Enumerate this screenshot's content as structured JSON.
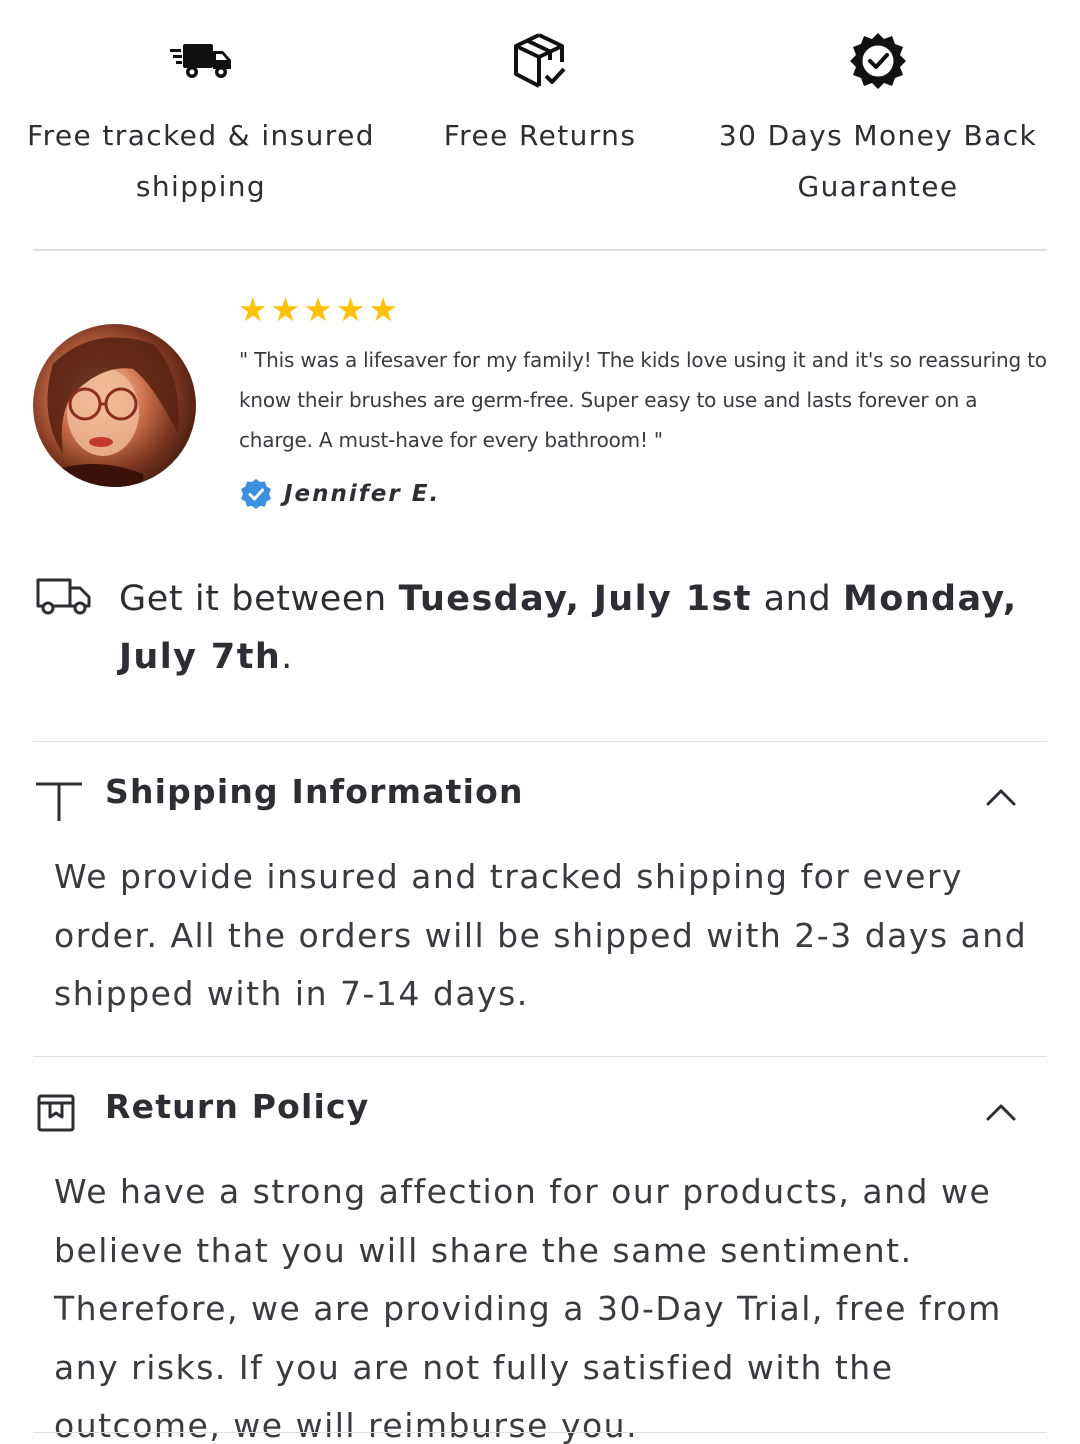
{
  "badges": [
    {
      "icon": "fast-truck-icon",
      "text": "Free tracked & insured shipping"
    },
    {
      "icon": "box-check-icon",
      "text": "Free Returns"
    },
    {
      "icon": "badge-check-icon",
      "text": "30 Days Money Back Guarantee"
    }
  ],
  "review": {
    "rating": 5,
    "stars": "★★★★★",
    "quote": "\" This was a lifesaver for my family! The kids love using it and it's so reassuring to know their brushes are germ-free. Super easy to use and lasts forever on a charge. A must-have for every bathroom! \"",
    "reviewer": "Jennifer E.",
    "verified_icon": "verified-check-icon",
    "star_color": "#ffc107",
    "verified_color": "#3d8fe0"
  },
  "delivery": {
    "icon": "delivery-truck-icon",
    "prefix": "Get it between ",
    "start": "Tuesday, July 1st",
    "middle": " and ",
    "end": "Monday, July 7th",
    "suffix": "."
  },
  "accordions": [
    {
      "icon": "truck-outline-icon",
      "title": "Shipping Information",
      "expanded": true,
      "body": "We provide insured and tracked shipping for every order. All the orders will be shipped with 2-3 days and shipped with in 7-14 days."
    },
    {
      "icon": "return-box-icon",
      "title": "Return Policy",
      "expanded": true,
      "body": "We have a strong affection for our products, and we believe that you will share the same sentiment. Therefore, we are providing a 30-Day Trial, free from any risks. If you are not fully satisfied with the outcome, we will reimburse you."
    }
  ]
}
